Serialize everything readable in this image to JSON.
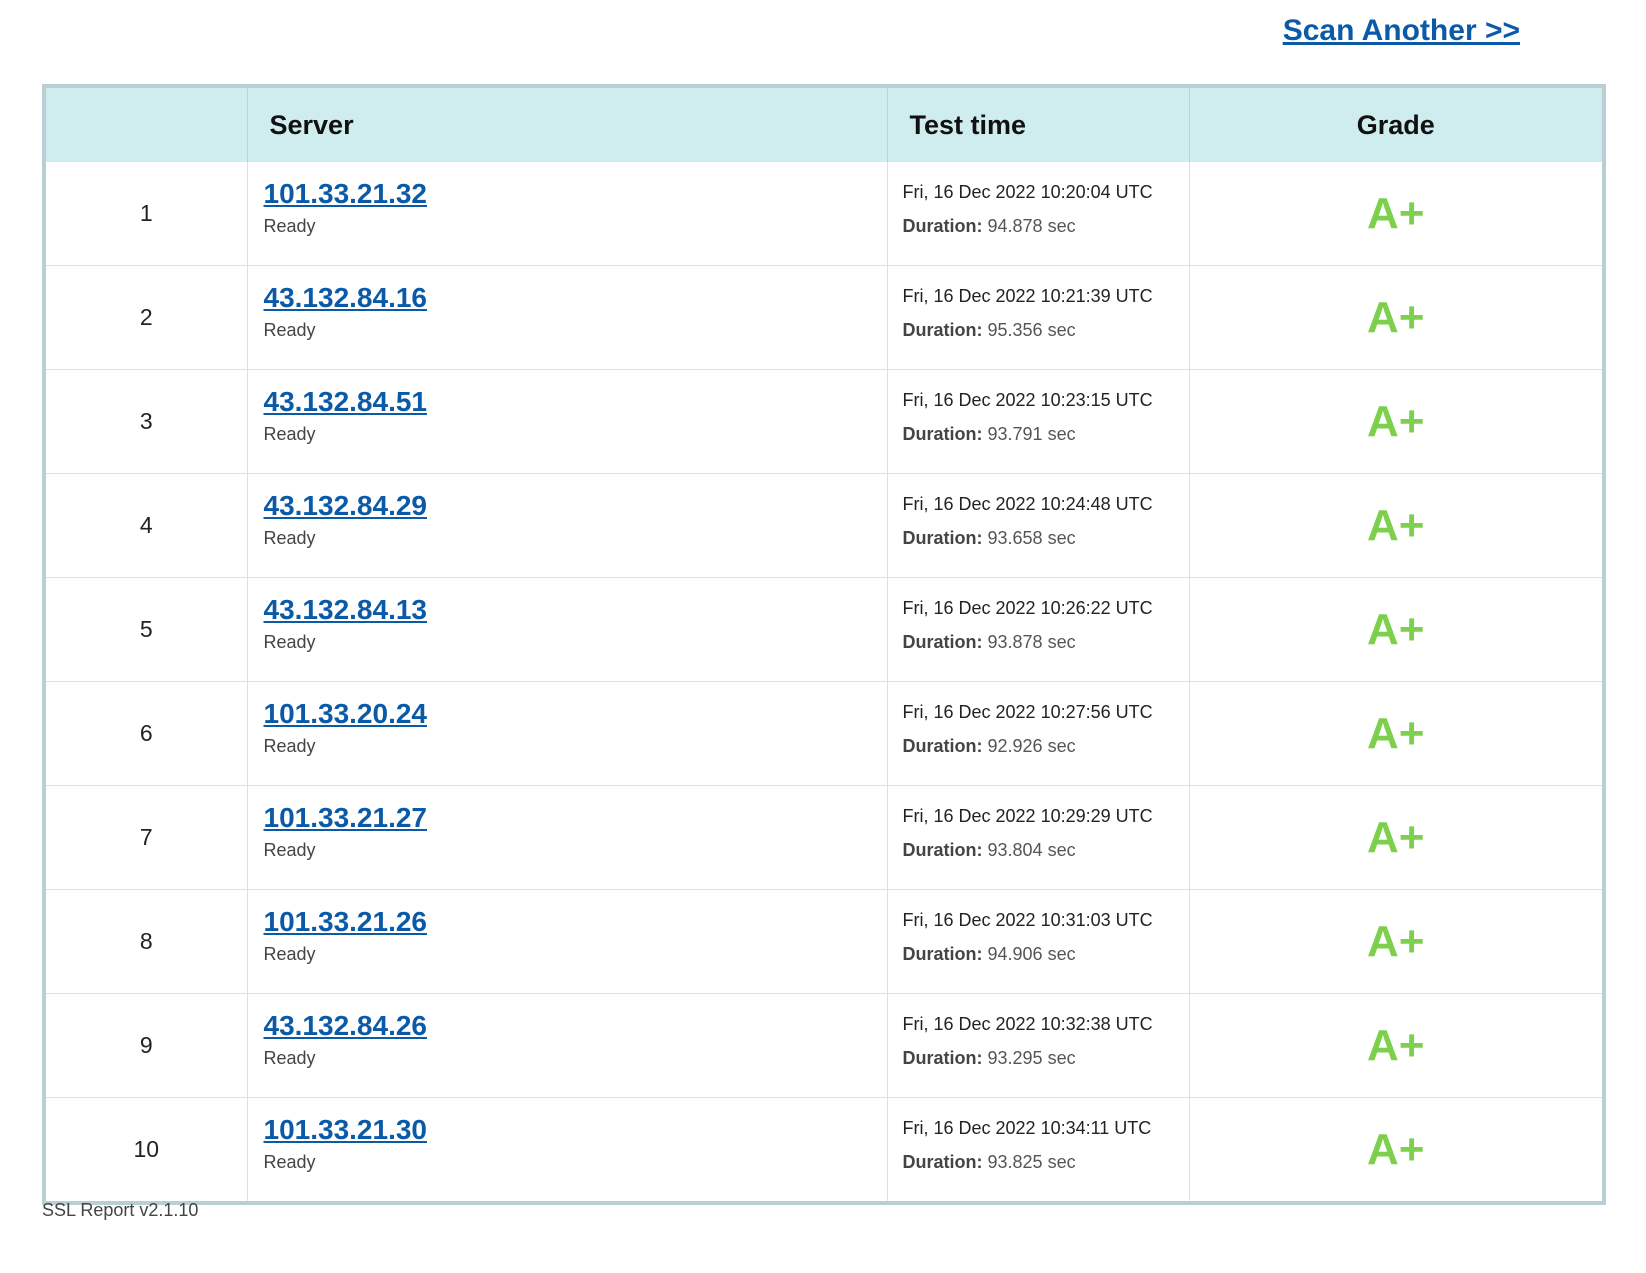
{
  "header": {
    "scan_another": "Scan Another >>"
  },
  "table": {
    "columns": {
      "number": "",
      "server": "Server",
      "test_time": "Test time",
      "grade": "Grade"
    },
    "duration_label": "Duration:",
    "rows": [
      {
        "num": "1",
        "server": "101.33.21.32",
        "status": "Ready",
        "time": "Fri, 16 Dec 2022 10:20:04 UTC",
        "duration": "94.878 sec",
        "grade": "A+"
      },
      {
        "num": "2",
        "server": "43.132.84.16",
        "status": "Ready",
        "time": "Fri, 16 Dec 2022 10:21:39 UTC",
        "duration": "95.356 sec",
        "grade": "A+"
      },
      {
        "num": "3",
        "server": "43.132.84.51",
        "status": "Ready",
        "time": "Fri, 16 Dec 2022 10:23:15 UTC",
        "duration": "93.791 sec",
        "grade": "A+"
      },
      {
        "num": "4",
        "server": "43.132.84.29",
        "status": "Ready",
        "time": "Fri, 16 Dec 2022 10:24:48 UTC",
        "duration": "93.658 sec",
        "grade": "A+"
      },
      {
        "num": "5",
        "server": "43.132.84.13",
        "status": "Ready",
        "time": "Fri, 16 Dec 2022 10:26:22 UTC",
        "duration": "93.878 sec",
        "grade": "A+"
      },
      {
        "num": "6",
        "server": "101.33.20.24",
        "status": "Ready",
        "time": "Fri, 16 Dec 2022 10:27:56 UTC",
        "duration": "92.926 sec",
        "grade": "A+"
      },
      {
        "num": "7",
        "server": "101.33.21.27",
        "status": "Ready",
        "time": "Fri, 16 Dec 2022 10:29:29 UTC",
        "duration": "93.804 sec",
        "grade": "A+"
      },
      {
        "num": "8",
        "server": "101.33.21.26",
        "status": "Ready",
        "time": "Fri, 16 Dec 2022 10:31:03 UTC",
        "duration": "94.906 sec",
        "grade": "A+"
      },
      {
        "num": "9",
        "server": "43.132.84.26",
        "status": "Ready",
        "time": "Fri, 16 Dec 2022 10:32:38 UTC",
        "duration": "93.295 sec",
        "grade": "A+"
      },
      {
        "num": "10",
        "server": "101.33.21.30",
        "status": "Ready",
        "time": "Fri, 16 Dec 2022 10:34:11 UTC",
        "duration": "93.825 sec",
        "grade": "A+"
      }
    ]
  },
  "footer": {
    "version": "SSL Report v2.1.10"
  },
  "colors": {
    "link": "#0b5aa8",
    "grade_a_plus": "#7cd04b",
    "header_bg": "#cfecee",
    "border": "#b9cfd3"
  }
}
